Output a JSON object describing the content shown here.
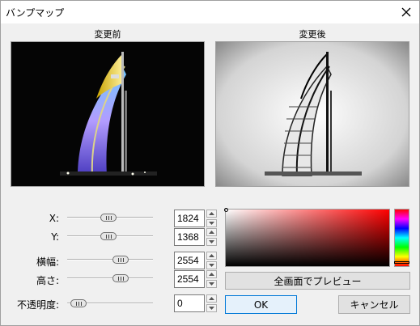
{
  "window": {
    "title": "バンプマップ"
  },
  "captions": {
    "before": "変更前",
    "after": "変更後"
  },
  "params": [
    {
      "label": "X:",
      "value": "1824",
      "level": 0.48
    },
    {
      "label": "Y:",
      "value": "1368",
      "level": 0.48
    },
    {
      "label": "横幅:",
      "value": "2554",
      "level": 0.67
    },
    {
      "label": "高さ:",
      "value": "2554",
      "level": 0.67
    },
    {
      "label": "不透明度:",
      "value": "0",
      "level": 0.0
    }
  ],
  "buttons": {
    "preview": "全画面でプレビュー",
    "ok": "OK",
    "cancel": "キャンセル"
  },
  "colors": {
    "accent": "#0078d7",
    "hue_red": "#ff0000"
  }
}
